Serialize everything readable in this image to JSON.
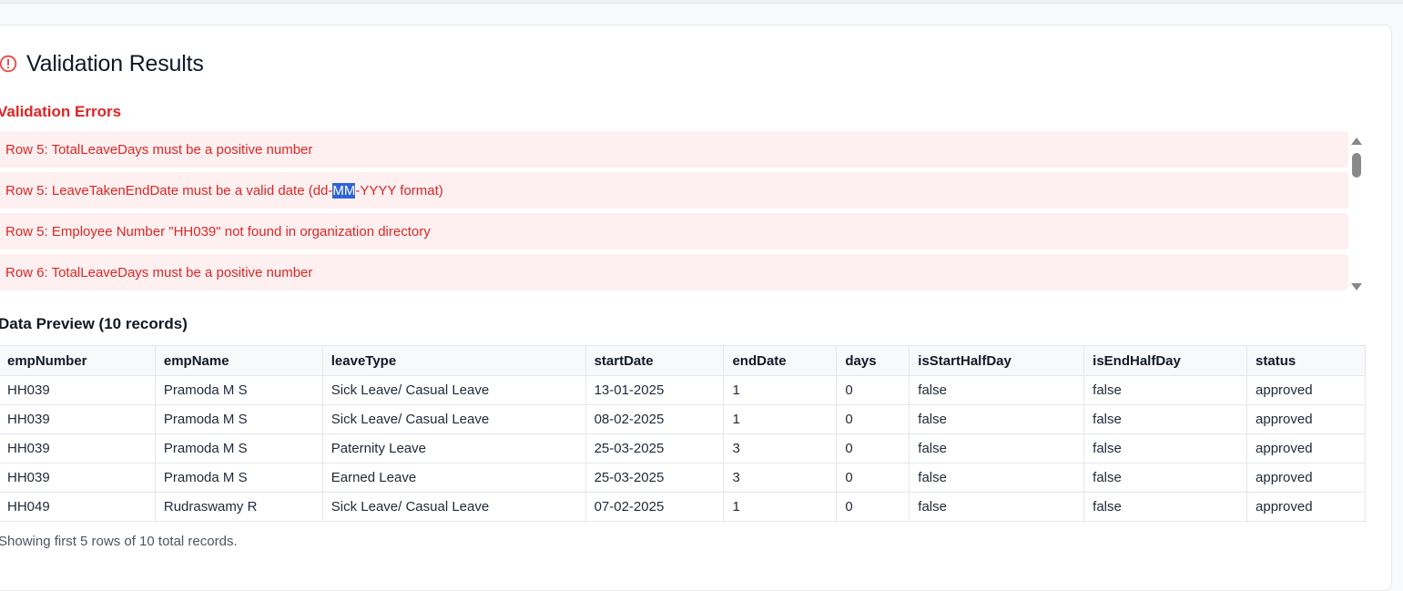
{
  "page": {
    "title": "Validation Results",
    "icon": "alert-circle-icon",
    "accent_error": "#dc2626"
  },
  "errors": {
    "heading": "Validation Errors",
    "items": [
      {
        "text": "Row 5: TotalLeaveDays must be a positive number"
      },
      {
        "pre": "Row 5: LeaveTakenEndDate must be a valid date (dd-",
        "selected": "MM",
        "post": "-YYYY format)"
      },
      {
        "text": "Row 5: Employee Number \"HH039\" not found in organization directory"
      },
      {
        "text": "Row 6: TotalLeaveDays must be a positive number"
      }
    ]
  },
  "preview": {
    "heading": "Data Preview (10 records)",
    "columns": [
      "empNumber",
      "empName",
      "leaveType",
      "startDate",
      "endDate",
      "days",
      "isStartHalfDay",
      "isEndHalfDay",
      "status"
    ],
    "rows": [
      [
        "HH039",
        "Pramoda M S",
        "Sick Leave/ Casual Leave",
        "13-01-2025",
        "1",
        "0",
        "false",
        "false",
        "approved"
      ],
      [
        "HH039",
        "Pramoda M S",
        "Sick Leave/ Casual Leave",
        "08-02-2025",
        "1",
        "0",
        "false",
        "false",
        "approved"
      ],
      [
        "HH039",
        "Pramoda M S",
        "Paternity Leave",
        "25-03-2025",
        "3",
        "0",
        "false",
        "false",
        "approved"
      ],
      [
        "HH039",
        "Pramoda M S",
        "Earned Leave",
        "25-03-2025",
        "3",
        "0",
        "false",
        "false",
        "approved"
      ],
      [
        "HH049",
        "Rudraswamy R",
        "Sick Leave/ Casual Leave",
        "07-02-2025",
        "1",
        "0",
        "false",
        "false",
        "approved"
      ]
    ],
    "footer": "Showing first 5 rows of 10 total records."
  }
}
